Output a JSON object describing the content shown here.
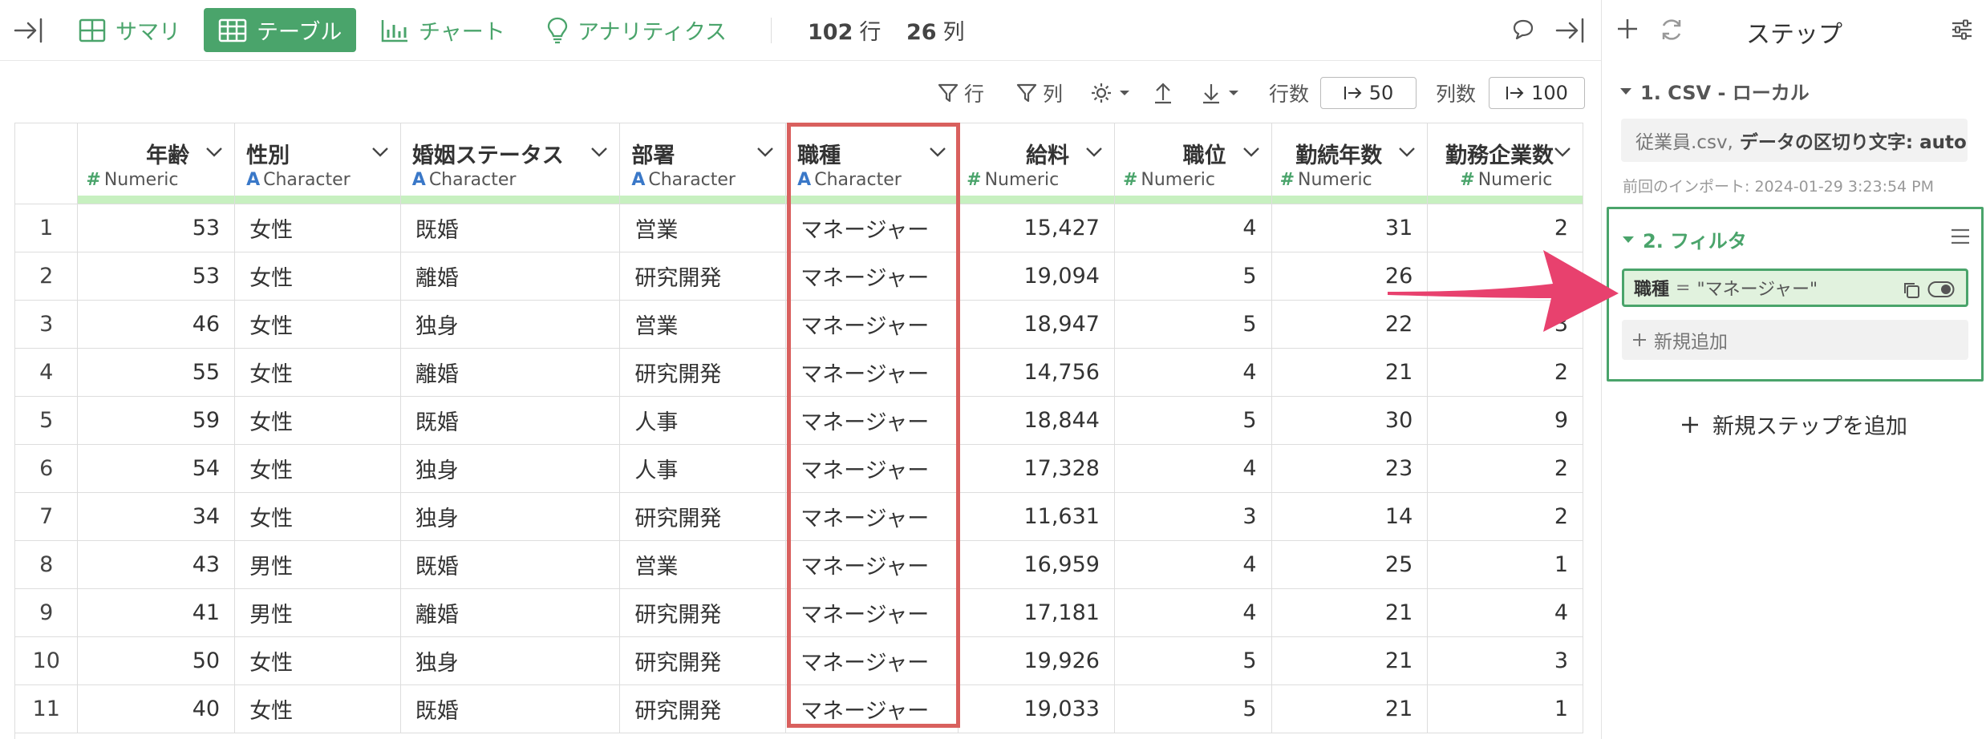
{
  "toolbar": {
    "tabs": [
      {
        "label": "サマリ",
        "icon": "summary-grid-icon"
      },
      {
        "label": "テーブル",
        "icon": "table-icon",
        "active": true
      },
      {
        "label": "チャート",
        "icon": "bar-chart-icon"
      },
      {
        "label": "アナリティクス",
        "icon": "lightbulb-icon"
      }
    ],
    "rows_count": "102",
    "rows_unit": "行",
    "cols_count": "26",
    "cols_unit": "列",
    "accent": "#4aa46b"
  },
  "subbar": {
    "row_filter": "行",
    "col_filter": "列",
    "rows_label": "行数",
    "rows_value": "50",
    "cols_label": "列数",
    "cols_value": "100"
  },
  "table": {
    "columns": [
      {
        "name": "年齢",
        "type": "Numeric",
        "kind": "num"
      },
      {
        "name": "性別",
        "type": "Character",
        "kind": "chr"
      },
      {
        "name": "婚姻ステータス",
        "type": "Character",
        "kind": "chr"
      },
      {
        "name": "部署",
        "type": "Character",
        "kind": "chr"
      },
      {
        "name": "職種",
        "type": "Character",
        "kind": "chr"
      },
      {
        "name": "給料",
        "type": "Numeric",
        "kind": "num"
      },
      {
        "name": "職位",
        "type": "Numeric",
        "kind": "num"
      },
      {
        "name": "勤続年数",
        "type": "Numeric",
        "kind": "num"
      },
      {
        "name": "勤務企業数",
        "type": "Numeric",
        "kind": "num"
      }
    ],
    "rows": [
      [
        "1",
        "53",
        "女性",
        "既婚",
        "営業",
        "マネージャー",
        "15,427",
        "4",
        "31",
        "2"
      ],
      [
        "2",
        "53",
        "女性",
        "離婚",
        "研究開発",
        "マネージャー",
        "19,094",
        "5",
        "26",
        "3"
      ],
      [
        "3",
        "46",
        "女性",
        "独身",
        "営業",
        "マネージャー",
        "18,947",
        "5",
        "22",
        "3"
      ],
      [
        "4",
        "55",
        "女性",
        "離婚",
        "研究開発",
        "マネージャー",
        "14,756",
        "4",
        "21",
        "2"
      ],
      [
        "5",
        "59",
        "女性",
        "既婚",
        "人事",
        "マネージャー",
        "18,844",
        "5",
        "30",
        "9"
      ],
      [
        "6",
        "54",
        "女性",
        "独身",
        "人事",
        "マネージャー",
        "17,328",
        "4",
        "23",
        "2"
      ],
      [
        "7",
        "34",
        "女性",
        "独身",
        "研究開発",
        "マネージャー",
        "11,631",
        "3",
        "14",
        "2"
      ],
      [
        "8",
        "43",
        "男性",
        "既婚",
        "営業",
        "マネージャー",
        "16,959",
        "4",
        "25",
        "1"
      ],
      [
        "9",
        "41",
        "男性",
        "離婚",
        "研究開発",
        "マネージャー",
        "17,181",
        "4",
        "21",
        "4"
      ],
      [
        "10",
        "50",
        "女性",
        "独身",
        "研究開発",
        "マネージャー",
        "19,926",
        "5",
        "21",
        "3"
      ],
      [
        "11",
        "40",
        "女性",
        "既婚",
        "研究開発",
        "マネージャー",
        "19,033",
        "5",
        "21",
        "1"
      ]
    ]
  },
  "panel": {
    "title": "ステップ",
    "step1": {
      "title": "1. CSV - ローカル",
      "file": "従業員.csv,",
      "option": "データの区切り文字: auto",
      "last_import": "前回のインポート: 2024-01-29 3:23:54 PM"
    },
    "step2": {
      "title": "2. フィルタ",
      "filter_column": "職種",
      "filter_op": "=",
      "filter_value": "\"マネージャー\"",
      "add_new": "新規追加"
    },
    "add_step": "新規ステップを追加"
  },
  "annotation_color": "#e8416e",
  "highlight_color": "#d9605e"
}
